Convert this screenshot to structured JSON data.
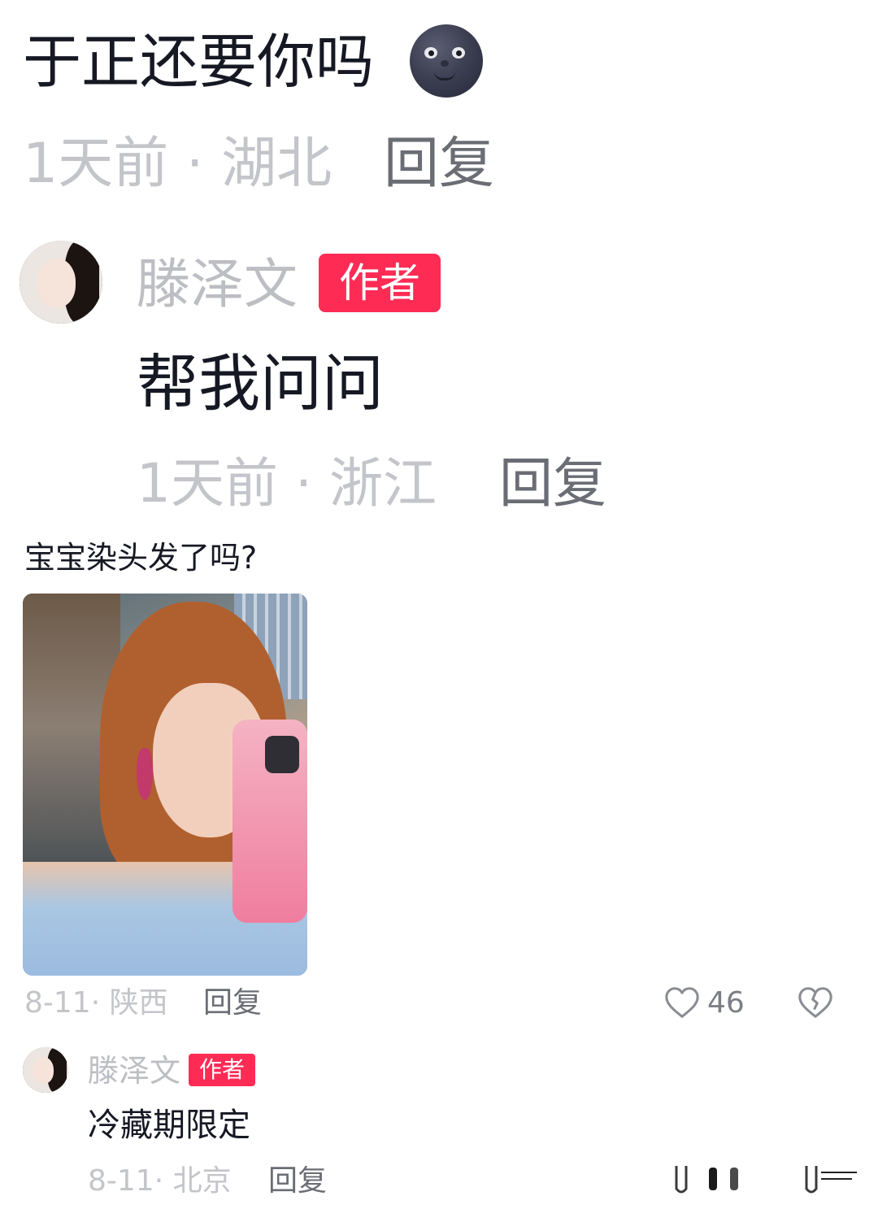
{
  "comment_top": {
    "text": "于正还要你吗",
    "emoji": "new-moon-face-emoji",
    "time": "1天前",
    "location": "湖北",
    "separator": "·",
    "reply_label": "回复"
  },
  "reply_top": {
    "author": "滕泽文",
    "badge": "作者",
    "text": "帮我问问",
    "time": "1天前",
    "location": "浙江",
    "separator": "·",
    "reply_label": "回复"
  },
  "comment_second": {
    "text": "宝宝染头发了吗?",
    "image": "selfie-photo",
    "date": "8-11",
    "location": "陕西",
    "separator": "·",
    "reply_label": "回复",
    "like_count": "46",
    "icons": {
      "like": "heart-outline-icon",
      "dislike": "broken-heart-icon"
    }
  },
  "reply_second": {
    "author": "滕泽文",
    "badge": "作者",
    "text": "冷藏期限定",
    "date": "8-11",
    "location": "北京",
    "separator": "·",
    "reply_label": "回复"
  },
  "colors": {
    "badge": "#fe2c55",
    "meta": "#c4c5ca",
    "reply": "#6b6d75",
    "text": "#161823"
  }
}
